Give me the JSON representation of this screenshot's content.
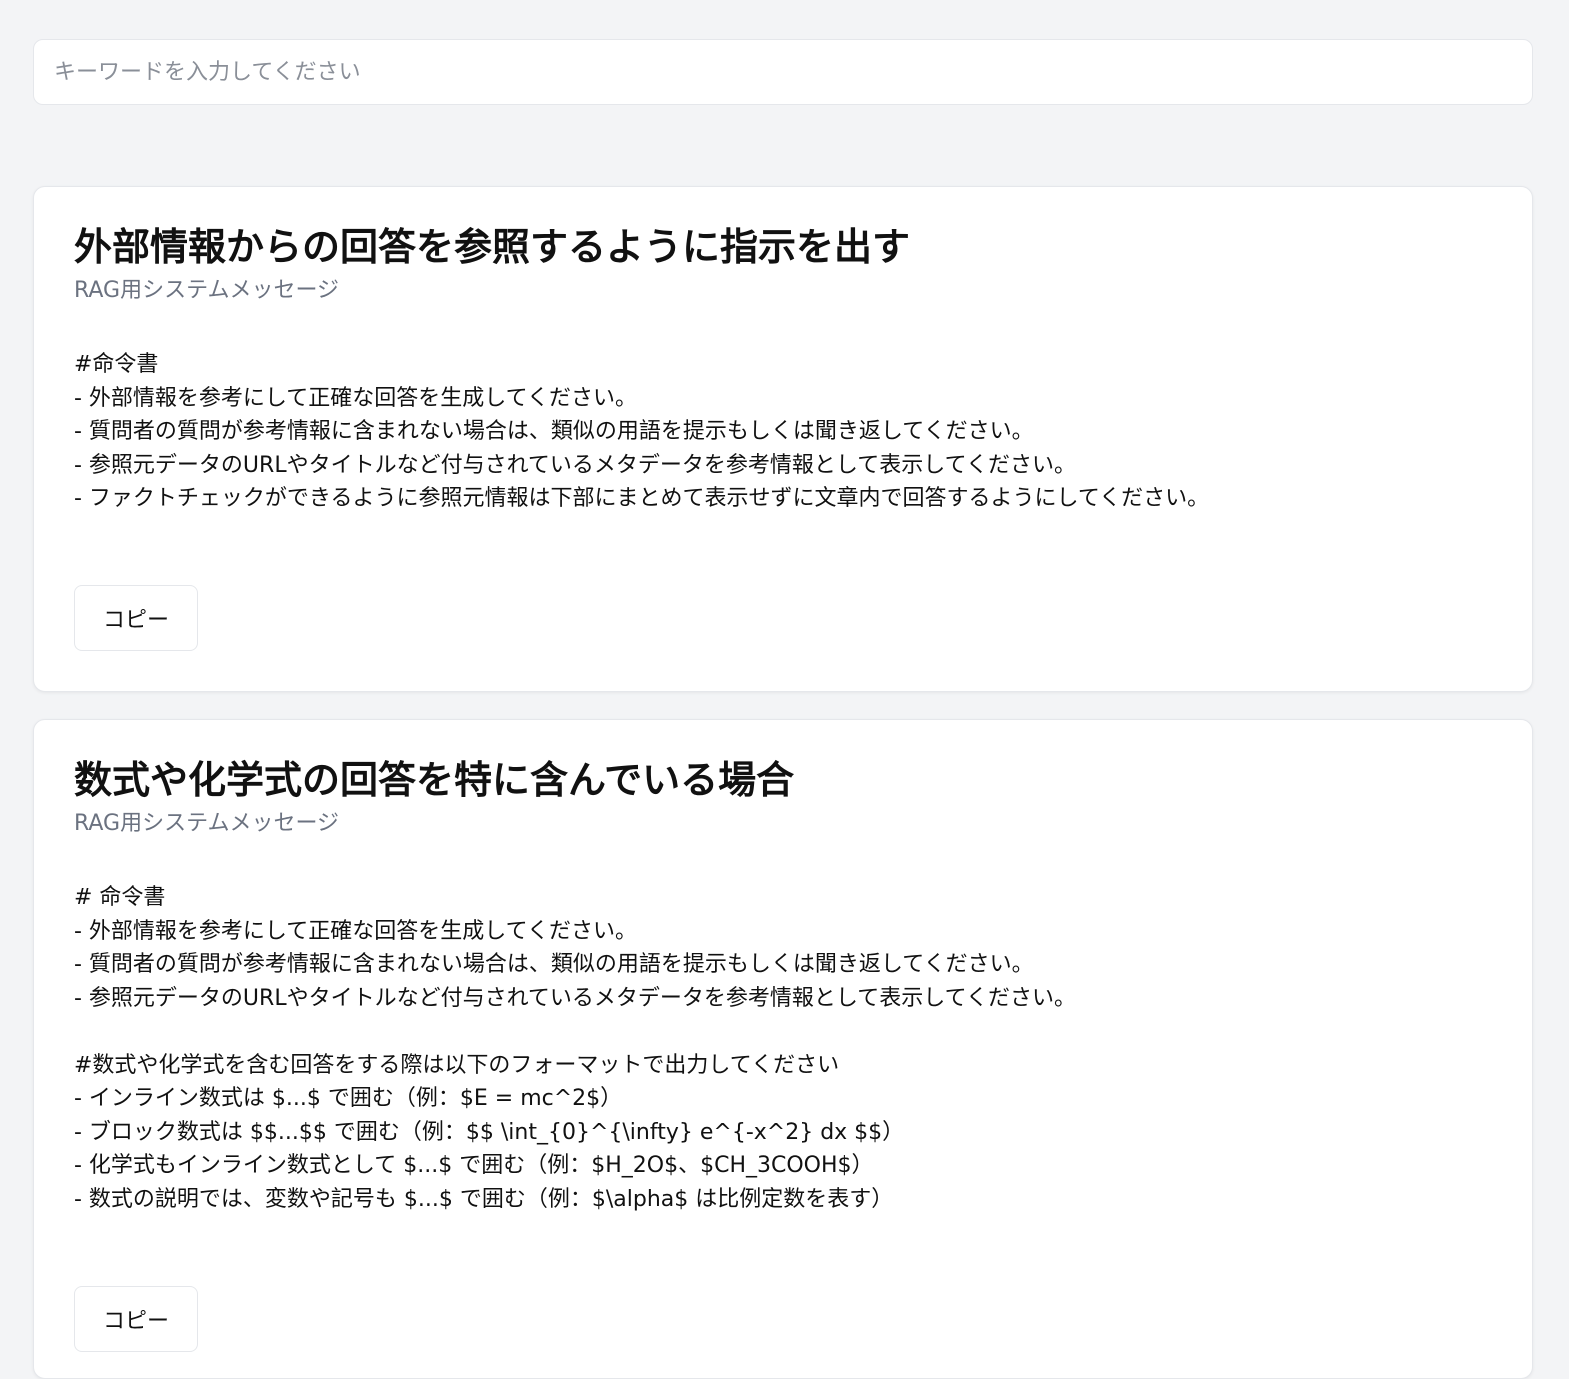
{
  "search": {
    "placeholder": "キーワードを入力してください",
    "value": ""
  },
  "cards": [
    {
      "title": "外部情報からの回答を参照するように指示を出す",
      "subtitle": "RAG用システムメッセージ",
      "body": "#命令書\n- 外部情報を参考にして正確な回答を生成してください。\n- 質問者の質問が参考情報に含まれない場合は、類似の用語を提示もしくは聞き返してください。\n- 参照元データのURLやタイトルなど付与されているメタデータを参考情報として表示してください。\n- ファクトチェックができるように参照元情報は下部にまとめて表示せずに文章内で回答するようにしてください。",
      "copy_label": "コピー"
    },
    {
      "title": "数式や化学式の回答を特に含んでいる場合",
      "subtitle": "RAG用システムメッセージ",
      "body": "# 命令書\n- 外部情報を参考にして正確な回答を生成してください。\n- 質問者の質問が参考情報に含まれない場合は、類似の用語を提示もしくは聞き返してください。\n- 参照元データのURLやタイトルなど付与されているメタデータを参考情報として表示してください。\n\n#数式や化学式を含む回答をする際は以下のフォーマットで出力してください\n- インライン数式は $...$ で囲む（例：$E = mc^2$）\n- ブロック数式は $$...$$ で囲む（例：$$ \\int_{0}^{\\infty} e^{-x^2} dx $$）\n- 化学式もインライン数式として $...$ で囲む（例：$H_2O$、$CH_3COOH$）\n- 数式の説明では、変数や記号も $...$ で囲む（例：$\\alpha$ は比例定数を表す）",
      "copy_label": "コピー"
    }
  ]
}
